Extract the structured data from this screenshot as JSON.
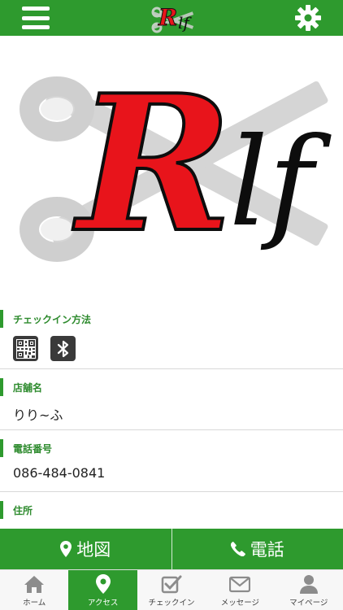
{
  "header": {
    "menu_icon": "hamburger-menu-icon",
    "logo_text": "Rlf",
    "settings_icon": "gear-icon"
  },
  "hero": {
    "logo_text_R": "R",
    "logo_text_lf": "lf"
  },
  "sections": {
    "checkin": {
      "title": "チェックイン方法",
      "icons": [
        "qr-code-icon",
        "bluetooth-icon"
      ]
    },
    "shop_name": {
      "title": "店舗名",
      "value": "りり~ふ"
    },
    "phone": {
      "title": "電話番号",
      "value": "086-484-0841"
    },
    "address": {
      "title": "住所"
    }
  },
  "actions": {
    "map_label": "地図",
    "phone_label": "電話"
  },
  "tabs": [
    {
      "label": "ホーム",
      "icon": "home-icon"
    },
    {
      "label": "アクセス",
      "icon": "location-pin-icon",
      "active": true
    },
    {
      "label": "チェックイン",
      "icon": "checkin-icon"
    },
    {
      "label": "メッセージ",
      "icon": "envelope-icon"
    },
    {
      "label": "マイページ",
      "icon": "person-icon"
    }
  ],
  "colors": {
    "brand_green": "#2e9a2e",
    "logo_red": "#e8141b",
    "dark": "#3a3a3a"
  }
}
